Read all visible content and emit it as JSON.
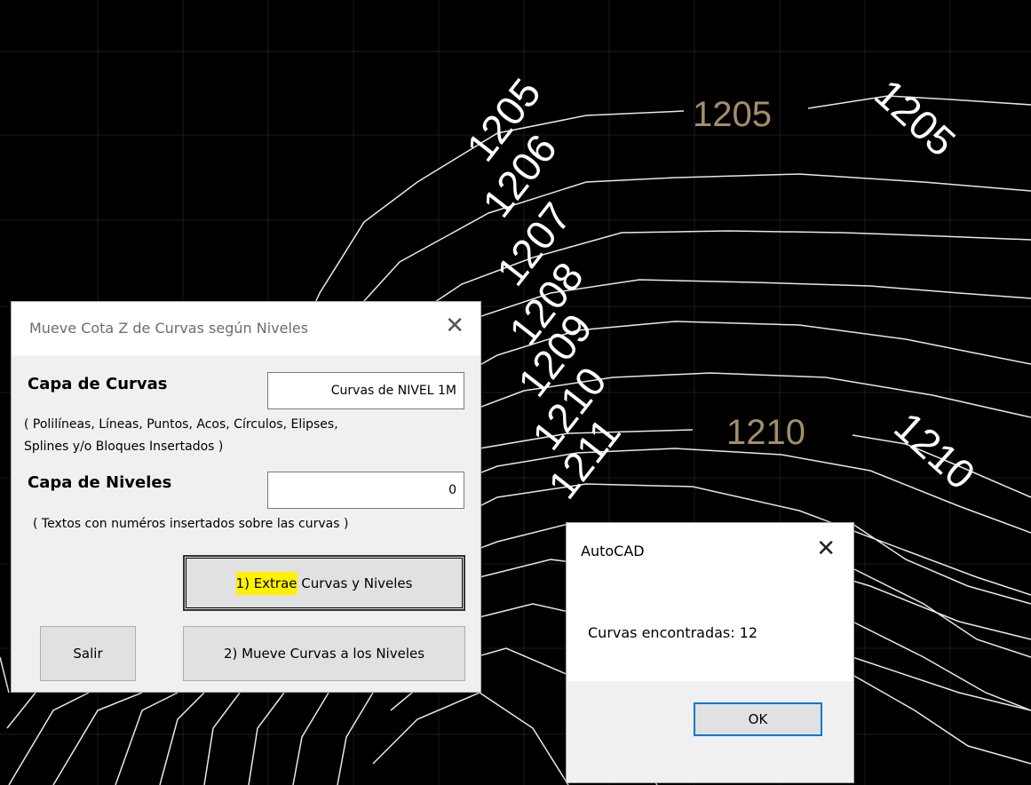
{
  "drawing": {
    "background": "#000000",
    "line_color": "#ffffff",
    "highlight_label_color": "#a48e6a",
    "contour_labels": [
      "1205",
      "1206",
      "1207",
      "1208",
      "1209",
      "1210",
      "1211"
    ],
    "highlight_labels": [
      "1205",
      "1210"
    ],
    "end_labels": [
      "1205",
      "1210"
    ]
  },
  "main_dialog": {
    "title": "Mueve Cota Z de Curvas según Niveles",
    "close_glyph": "✕",
    "capa_curvas_label": "Capa de Curvas",
    "capa_curvas_value": "Curvas de NIVEL 1M",
    "curvas_hint_line1": "( Polilíneas, Líneas, Puntos, Acos, Círculos, Elipses,",
    "curvas_hint_line2": "Splines y/o Bloques Insertados )",
    "capa_niveles_label": "Capa de Niveles",
    "capa_niveles_value": "0",
    "niveles_hint": "( Textos con numéros insertados sobre las curvas )",
    "extrae_button_hl": "1) Extrae",
    "extrae_button_rest": " Curvas y Niveles",
    "salir_button": "Salir",
    "mueve_button": "2) Mueve Curvas a los Niveles"
  },
  "autocad_dialog": {
    "title": "AutoCAD",
    "close_glyph": "✕",
    "message": "Curvas encontradas: 12",
    "ok_button": "OK"
  }
}
